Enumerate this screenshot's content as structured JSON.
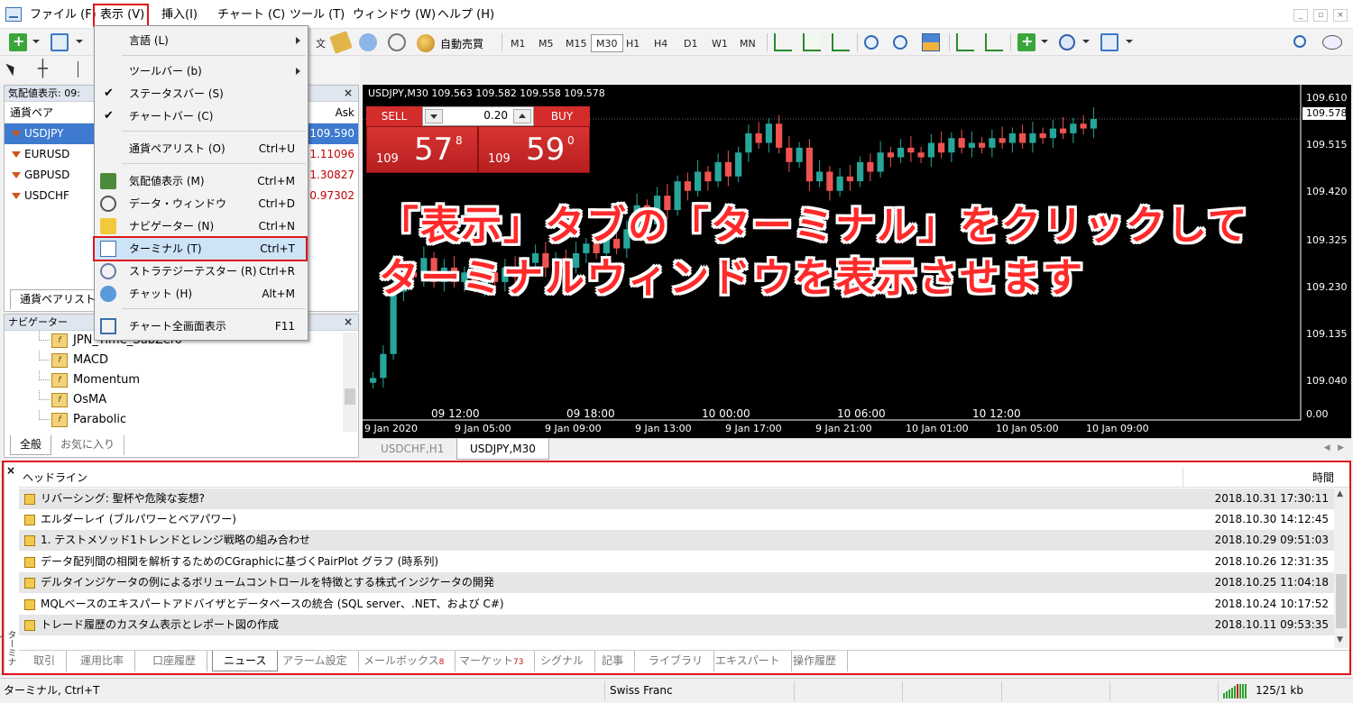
{
  "menubar": {
    "items": [
      "ファイル (F)",
      "表示 (V)",
      "挿入(I)",
      "チャート (C)",
      "ツール (T)",
      "ウィンドウ (W)",
      "ヘルプ (H)"
    ]
  },
  "toolbar": {
    "timeframes": [
      "M1",
      "M5",
      "M15",
      "M30",
      "H1",
      "H4",
      "D1",
      "W1",
      "MN"
    ],
    "active_timeframe": "M30",
    "auto_trade_label": "自動売買",
    "partial_label": "文"
  },
  "market_watch": {
    "title": "気配値表示: 09:",
    "col_symbol": "通貨ペア",
    "col_ask": "Ask",
    "rows": [
      {
        "symbol": "USDJPY",
        "ask": "109.590"
      },
      {
        "symbol": "EURUSD",
        "ask": "1.11096"
      },
      {
        "symbol": "GBPUSD",
        "ask": "1.30827"
      },
      {
        "symbol": "USDCHF",
        "ask": "0.97302"
      }
    ],
    "tab_label": "通貨ペアリスト"
  },
  "view_menu": {
    "items": [
      {
        "label": "言語 (L)",
        "shortcut": "",
        "submenu": true
      },
      {
        "label": "ツールバー (b)",
        "shortcut": "",
        "submenu": true
      },
      {
        "label": "ステータスバー (S)",
        "shortcut": "",
        "checked": true
      },
      {
        "label": "チャートバー (C)",
        "shortcut": "",
        "checked": true
      },
      {
        "label": "通貨ペアリスト (O)",
        "shortcut": "Ctrl+U"
      },
      {
        "label": "気配値表示 (M)",
        "shortcut": "Ctrl+M"
      },
      {
        "label": "データ・ウィンドウ",
        "shortcut": "Ctrl+D"
      },
      {
        "label": "ナビゲーター (N)",
        "shortcut": "Ctrl+N"
      },
      {
        "label": "ターミナル (T)",
        "shortcut": "Ctrl+T"
      },
      {
        "label": "ストラテジーテスター (R)",
        "shortcut": "Ctrl+R"
      },
      {
        "label": "チャット (H)",
        "shortcut": "Alt+M"
      },
      {
        "label": "チャート全画面表示",
        "shortcut": "F11"
      }
    ]
  },
  "navigator": {
    "title": "ナビゲーター",
    "items": [
      "JPN_Time_SubZero",
      "MACD",
      "Momentum",
      "OsMA",
      "Parabolic"
    ],
    "tabs": [
      "全般",
      "お気に入り"
    ]
  },
  "chart": {
    "info": "USDJPY,M30  109.563 109.582 109.558 109.578",
    "sell_label": "SELL",
    "buy_label": "BUY",
    "lot": "0.20",
    "sell_price": {
      "big": "109",
      "pips": "57",
      "sup": "8"
    },
    "buy_price": {
      "big": "109",
      "pips": "59",
      "sup": "0"
    },
    "current_price": "109.578",
    "annotation_line1": "「表示」タブの「ターミナル」をクリックして",
    "annotation_line2": "ターミナルウィンドウを表示させます",
    "tabs": [
      "USDCHF,H1",
      "USDJPY,M30"
    ],
    "active_tab": "USDJPY,M30"
  },
  "chart_data": {
    "type": "candlestick",
    "y_ticks": [
      "109.610",
      "109.515",
      "109.420",
      "109.325",
      "109.230",
      "109.135",
      "109.040",
      "0.00"
    ],
    "ylim": [
      108.99,
      109.64
    ],
    "date_labels": [
      "09 12:00",
      "09 18:00",
      "10 00:00",
      "10 06:00",
      "10 12:00"
    ],
    "time_labels": [
      "9 Jan 2020",
      "9 Jan 05:00",
      "9 Jan 09:00",
      "9 Jan 13:00",
      "9 Jan 17:00",
      "9 Jan 21:00",
      "10 Jan 01:00",
      "10 Jan 05:00",
      "10 Jan 09:00"
    ],
    "close": [
      109.04,
      109.09,
      109.22,
      109.26,
      109.25,
      109.29,
      109.24,
      109.27,
      109.24,
      109.26,
      109.23,
      109.26,
      109.24,
      109.27,
      109.25,
      109.28,
      109.3,
      109.27,
      109.29,
      109.27,
      109.3,
      109.32,
      109.3,
      109.33,
      109.31,
      109.35,
      109.4,
      109.36,
      109.42,
      109.39,
      109.45,
      109.43,
      109.47,
      109.45,
      109.49,
      109.46,
      109.51,
      109.55,
      109.53,
      109.57,
      109.52,
      109.49,
      109.52,
      109.45,
      109.47,
      109.43,
      109.46,
      109.45,
      109.49,
      109.47,
      109.51,
      109.5,
      109.52,
      109.51,
      109.5,
      109.53,
      109.51,
      109.54,
      109.52,
      109.53,
      109.52,
      109.54,
      109.53,
      109.55,
      109.53,
      109.55,
      109.54,
      109.56,
      109.55,
      109.57,
      109.56,
      109.58
    ]
  },
  "terminal": {
    "col_headline": "ヘッドライン",
    "col_time": "時間",
    "side_label": "ターミナル",
    "news": [
      {
        "title": "リバーシング: 聖杯や危険な妄想?",
        "time": "2018.10.31 17:30:11"
      },
      {
        "title": "エルダーレイ (ブルパワーとベアパワー)",
        "time": "2018.10.30 14:12:45"
      },
      {
        "title": "1. テストメソッド1トレンドとレンジ戦略の組み合わせ",
        "time": "2018.10.29 09:51:03"
      },
      {
        "title": "データ配列間の相関を解析するためのCGraphicに基づくPairPlot グラフ (時系列)",
        "time": "2018.10.26 12:31:35"
      },
      {
        "title": "デルタインジケータの例によるボリュームコントロールを特徴とする株式インジケータの開発",
        "time": "2018.10.25 11:04:18"
      },
      {
        "title": "MQLベースのエキスパートアドバイザとデータベースの統合 (SQL server、.NET、および C#)",
        "time": "2018.10.24 10:17:52"
      },
      {
        "title": "トレード履歴のカスタム表示とレポート図の作成",
        "time": "2018.10.11 09:53:35"
      }
    ],
    "tabs": [
      {
        "label": "取引",
        "badge": ""
      },
      {
        "label": "運用比率",
        "badge": ""
      },
      {
        "label": "口座履歴",
        "badge": ""
      },
      {
        "label": "ニュース",
        "badge": ""
      },
      {
        "label": "アラーム設定",
        "badge": ""
      },
      {
        "label": "メールボックス",
        "badge": "8"
      },
      {
        "label": "マーケット",
        "badge": "73"
      },
      {
        "label": "シグナル",
        "badge": ""
      },
      {
        "label": "記事",
        "badge": ""
      },
      {
        "label": "ライブラリ",
        "badge": ""
      },
      {
        "label": "エキスパート",
        "badge": ""
      },
      {
        "label": "操作履歴",
        "badge": ""
      }
    ],
    "active_tab": "ニュース"
  },
  "statusbar": {
    "hint": "ターミナル, Ctrl+T",
    "profile": "Swiss Franc",
    "connection": "125/1 kb"
  },
  "colors": {
    "highlight": "#e0141c",
    "bull": "#26a69a",
    "bear": "#ef5350",
    "sell_buy": "#d42b2b"
  }
}
